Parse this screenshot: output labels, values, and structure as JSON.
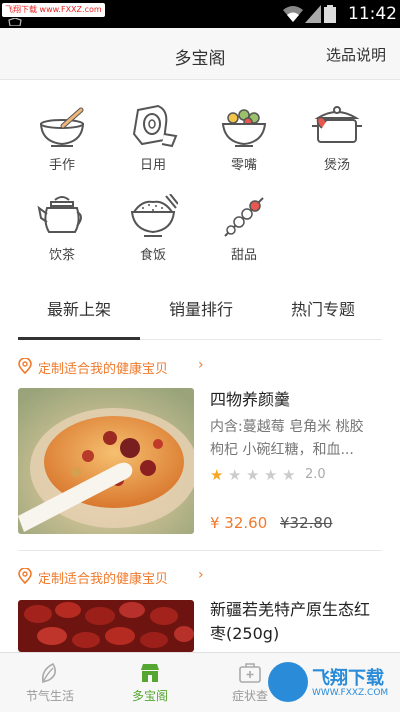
{
  "status_bar": {
    "watermark": "飞翔下载 www.FXXZ.com",
    "time": "11:42"
  },
  "header": {
    "title": "多宝阁",
    "right_link": "选品说明"
  },
  "categories": [
    {
      "label": "手作",
      "icon": "mortar-icon"
    },
    {
      "label": "日用",
      "icon": "tissue-roll-icon"
    },
    {
      "label": "零嘴",
      "icon": "snack-bowl-icon"
    },
    {
      "label": "煲汤",
      "icon": "soup-pot-icon"
    },
    {
      "label": "饮茶",
      "icon": "teapot-icon"
    },
    {
      "label": "食饭",
      "icon": "rice-bowl-icon"
    },
    {
      "label": "甜品",
      "icon": "skewer-icon"
    }
  ],
  "tabs": [
    {
      "label": "最新上架",
      "active": true
    },
    {
      "label": "销量排行",
      "active": false
    },
    {
      "label": "热门专题",
      "active": false
    }
  ],
  "products": [
    {
      "promo": "定制适合我的健康宝贝",
      "name": "四物养颜羹",
      "desc": "内含:蔓越莓 皂角米 桃胶 枸杞 小碗红糖，和血...",
      "rating": "2.0",
      "rating_value": 1,
      "price": "¥ 32.60",
      "old_price": "¥32.80"
    },
    {
      "promo": "定制适合我的健康宝贝",
      "name": "新疆若羌特产原生态红枣(250g)"
    }
  ],
  "bottom_nav": [
    {
      "label": "节气生活",
      "icon": "leaf-icon",
      "active": false
    },
    {
      "label": "多宝阁",
      "icon": "store-icon",
      "active": true
    },
    {
      "label": "症状查",
      "icon": "medical-kit-icon",
      "active": false
    }
  ],
  "watermark_logo": {
    "name": "飞翔下载",
    "url": "WWW.FXXZ.COM"
  },
  "colors": {
    "accent": "#f07a2c",
    "active_nav": "#55a630",
    "star": "#f5a623"
  }
}
